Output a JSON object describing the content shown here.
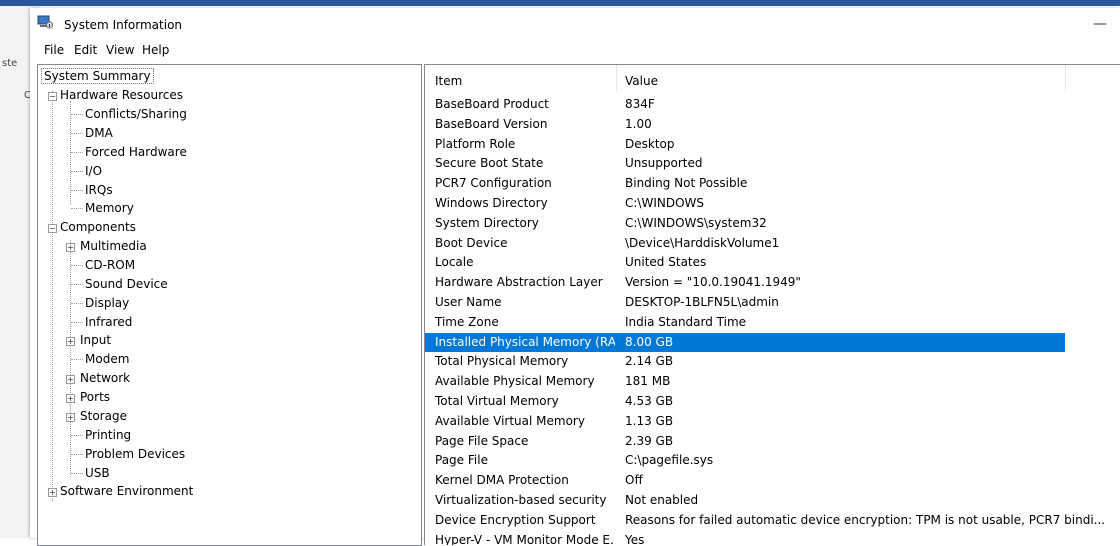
{
  "window": {
    "title": "System Information",
    "minimize_symbol": "—"
  },
  "menu": [
    "File",
    "Edit",
    "View",
    "Help"
  ],
  "background_app": {
    "fragment_a": "ste",
    "fragment_b": "Cli"
  },
  "tree": {
    "root": "System Summary",
    "groups": [
      {
        "label": "Hardware Resources",
        "expanded": true,
        "children": [
          "Conflicts/Sharing",
          "DMA",
          "Forced Hardware",
          "I/O",
          "IRQs",
          "Memory"
        ]
      },
      {
        "label": "Components",
        "expanded": true,
        "children": [
          {
            "label": "Multimedia",
            "expandable": true
          },
          {
            "label": "CD-ROM",
            "expandable": false
          },
          {
            "label": "Sound Device",
            "expandable": false
          },
          {
            "label": "Display",
            "expandable": false
          },
          {
            "label": "Infrared",
            "expandable": false
          },
          {
            "label": "Input",
            "expandable": true
          },
          {
            "label": "Modem",
            "expandable": false
          },
          {
            "label": "Network",
            "expandable": true
          },
          {
            "label": "Ports",
            "expandable": true
          },
          {
            "label": "Storage",
            "expandable": true
          },
          {
            "label": "Printing",
            "expandable": false
          },
          {
            "label": "Problem Devices",
            "expandable": false
          },
          {
            "label": "USB",
            "expandable": false
          }
        ]
      },
      {
        "label": "Software Environment",
        "expanded": false,
        "children": []
      }
    ]
  },
  "details": {
    "columns": [
      "Item",
      "Value"
    ],
    "selected_index": 13,
    "selection_color": "#0078d7",
    "rows": [
      [
        "BaseBoard Product",
        "834F"
      ],
      [
        "BaseBoard Version",
        "1.00"
      ],
      [
        "Platform Role",
        "Desktop"
      ],
      [
        "Secure Boot State",
        "Unsupported"
      ],
      [
        "PCR7 Configuration",
        "Binding Not Possible"
      ],
      [
        "Windows Directory",
        "C:\\WINDOWS"
      ],
      [
        "System Directory",
        "C:\\WINDOWS\\system32"
      ],
      [
        "Boot Device",
        "\\Device\\HarddiskVolume1"
      ],
      [
        "Locale",
        "United States"
      ],
      [
        "Hardware Abstraction Layer",
        "Version = \"10.0.19041.1949\""
      ],
      [
        "User Name",
        "DESKTOP-1BLFN5L\\admin"
      ],
      [
        "Time Zone",
        "India Standard Time"
      ],
      [
        "Installed Physical Memory (RAM)",
        "8.00 GB"
      ],
      [
        "Total Physical Memory",
        "2.14 GB"
      ],
      [
        "Available Physical Memory",
        "181 MB"
      ],
      [
        "Total Virtual Memory",
        "4.53 GB"
      ],
      [
        "Available Virtual Memory",
        "1.13 GB"
      ],
      [
        "Page File Space",
        "2.39 GB"
      ],
      [
        "Page File",
        "C:\\pagefile.sys"
      ],
      [
        "Kernel DMA Protection",
        "Off"
      ],
      [
        "Virtualization-based security",
        "Not enabled"
      ],
      [
        "Device Encryption Support",
        "Reasons for failed automatic device encryption: TPM is not usable, PCR7 bindi..."
      ],
      [
        "Hyper-V - VM Monitor Mode E...",
        "Yes"
      ]
    ]
  }
}
